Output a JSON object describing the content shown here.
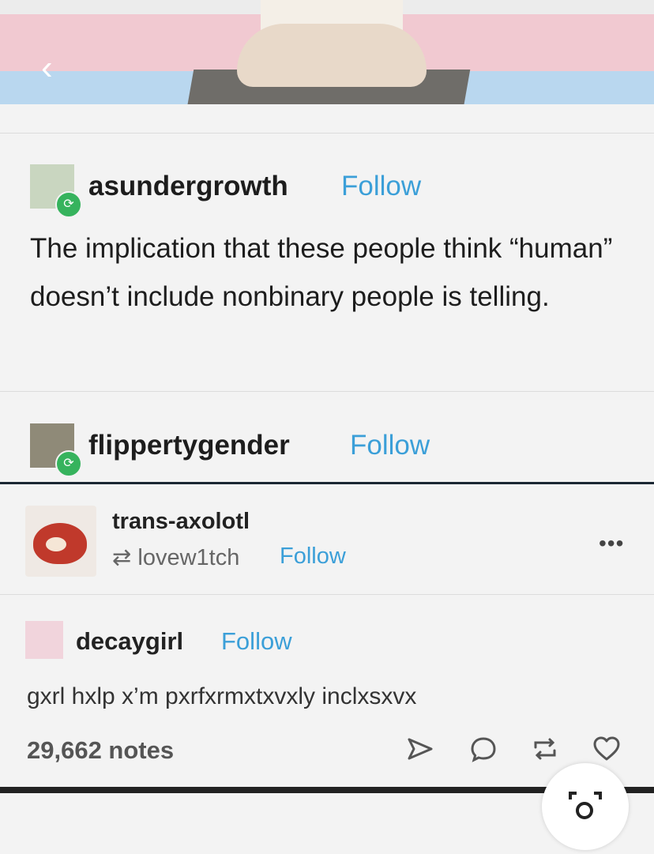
{
  "post1": {
    "username": "asundergrowth",
    "follow_label": "Follow",
    "text": "The implication that these people think “human” doesn’t include nonbinary people is telling."
  },
  "post2": {
    "username": "flippertygender",
    "follow_label": "Follow"
  },
  "post3": {
    "username": "trans-axolotl",
    "reblogged_from": "lovew1tch",
    "follow_label": "Follow"
  },
  "post4": {
    "username": "decaygirl",
    "follow_label": "Follow",
    "text": "gxrl hxlp x’m pxrfxrmxtxvxly inclxsxvx"
  },
  "footer": {
    "notes": "29,662 notes"
  },
  "icons": {
    "back": "chevron-left-icon",
    "reblog": "reblog-icon",
    "share": "share-icon",
    "comment": "comment-icon",
    "like": "heart-icon",
    "more": "more-icon"
  },
  "colors": {
    "link": "#3b9fd8",
    "reblog_badge": "#36b35d",
    "trans_pink": "#f1c9d1",
    "trans_blue": "#b9d7ef"
  }
}
